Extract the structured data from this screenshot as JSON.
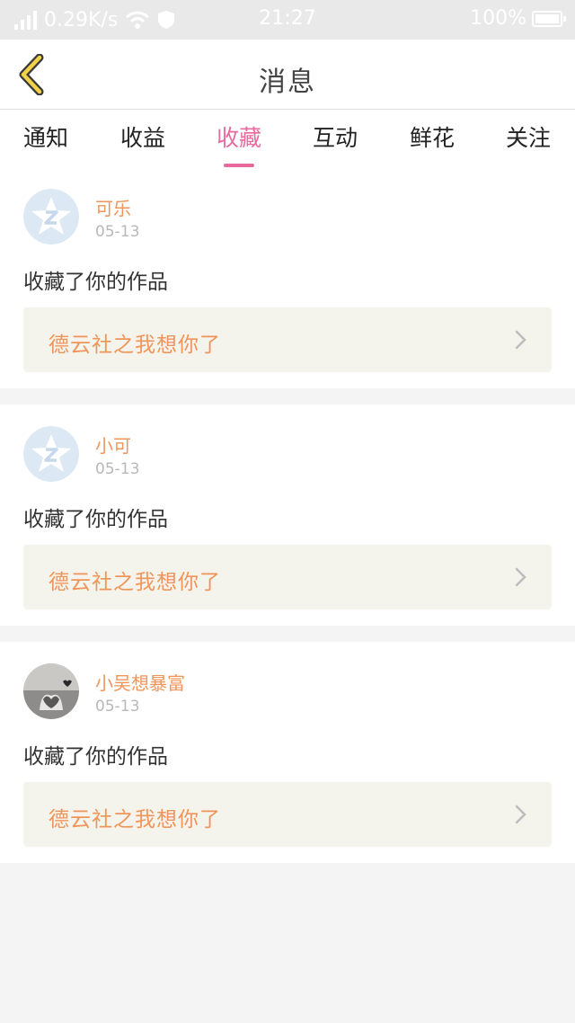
{
  "status_bar": {
    "network_speed": "0.29K/s",
    "time": "21:27",
    "battery": "100%"
  },
  "header": {
    "title": "消息"
  },
  "tabs": [
    {
      "label": "通知",
      "active": false
    },
    {
      "label": "收益",
      "active": false
    },
    {
      "label": "收藏",
      "active": true
    },
    {
      "label": "互动",
      "active": false
    },
    {
      "label": "鲜花",
      "active": false
    },
    {
      "label": "关注",
      "active": false
    }
  ],
  "messages": [
    {
      "username": "可乐",
      "date": "05-13",
      "action": "收藏了你的作品",
      "work_title": "德云社之我想你了",
      "avatar": "default-star-avatar"
    },
    {
      "username": "小可",
      "date": "05-13",
      "action": "收藏了你的作品",
      "work_title": "德云社之我想你了",
      "avatar": "default-star-avatar"
    },
    {
      "username": "小吴想暴富",
      "date": "05-13",
      "action": "收藏了你的作品",
      "work_title": "德云社之我想你了",
      "avatar": "photo-avatar"
    }
  ],
  "colors": {
    "accent": "#e86a9e",
    "username": "#f0955a",
    "work_box_bg": "#f4f3ec",
    "back_icon": "#f2d24a"
  }
}
